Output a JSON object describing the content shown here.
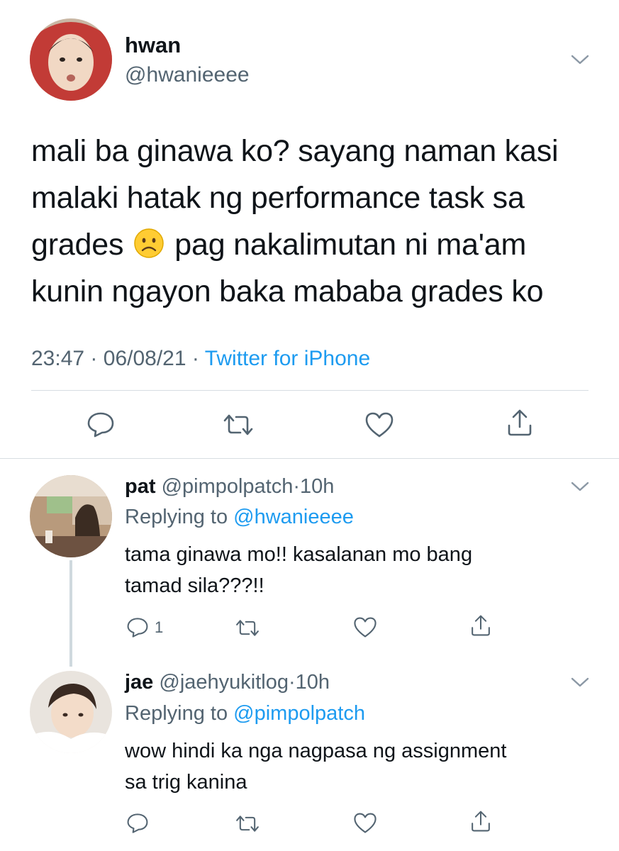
{
  "main_tweet": {
    "name": "hwan",
    "handle": "@hwanieeee",
    "text_lines": [
      "mali ba ginawa ko? sayang naman kasi",
      "malaki hatak ng performance task sa",
      "grades",
      "pag nakalimutan ni ma'am",
      "kunin ngayon baka mababa grades ko"
    ],
    "emoji": "frowning-face-emoji",
    "time": "23:47",
    "date": "06/08/21",
    "separator": "·",
    "source": "Twitter for iPhone"
  },
  "replies": [
    {
      "name": "pat",
      "handle": "@pimpolpatch",
      "age": "10h",
      "replying_label": "Replying to",
      "replying_to": "@hwanieeee",
      "text_lines": [
        "tama ginawa mo!! kasalanan mo bang",
        "tamad sila???!!"
      ],
      "reply_count": "1"
    },
    {
      "name": "jae",
      "handle": "@jaehyukitlog",
      "age": "10h",
      "replying_label": "Replying to",
      "replying_to": "@pimpolpatch",
      "text_lines": [
        "wow hindi ka nga nagpasa ng assignment",
        "sa trig kanina"
      ],
      "reply_count": ""
    }
  ],
  "colors": {
    "accent": "#1d9bf0",
    "secondary_text": "#536471",
    "primary_text": "#0f1419",
    "divider": "#d7dde2"
  },
  "icons": [
    "reply-icon",
    "retweet-icon",
    "like-icon",
    "share-icon",
    "chevron-down-icon"
  ]
}
